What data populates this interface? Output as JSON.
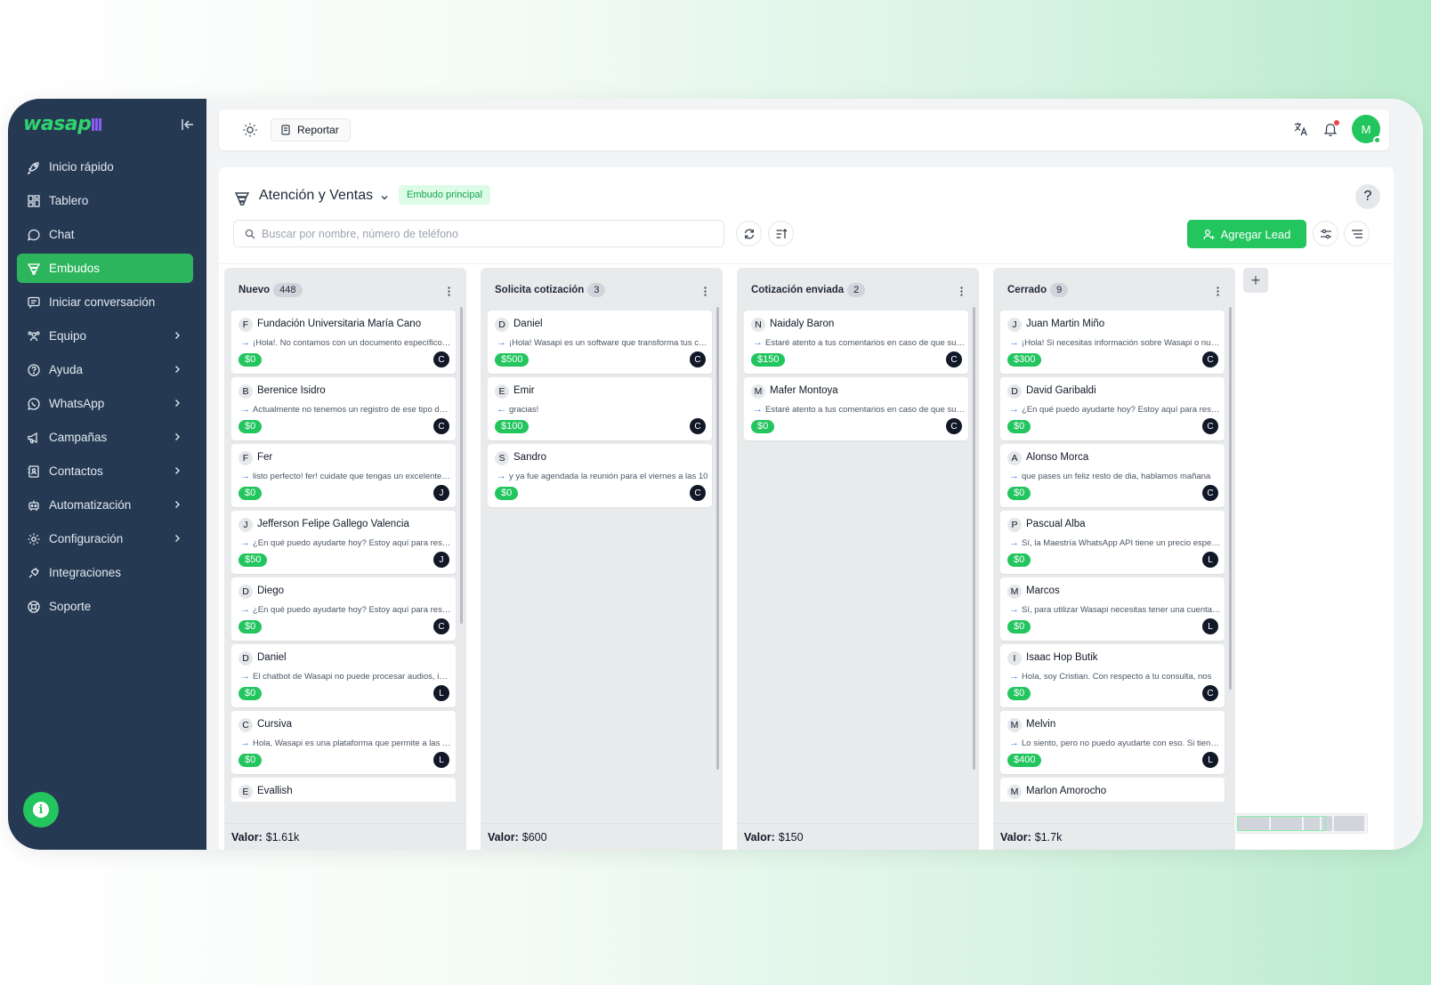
{
  "app": {
    "logo_text": "wasap",
    "brand_color": "#22c55e",
    "sidebar_color": "#253a52"
  },
  "sidebar": {
    "items": [
      {
        "label": "Inicio rápido",
        "icon": "rocket-icon",
        "chevron": false,
        "active": false
      },
      {
        "label": "Tablero",
        "icon": "dashboard-icon",
        "chevron": false,
        "active": false
      },
      {
        "label": "Chat",
        "icon": "chat-bubble-icon",
        "chevron": false,
        "active": false
      },
      {
        "label": "Embudos",
        "icon": "funnel-icon",
        "chevron": false,
        "active": true
      },
      {
        "label": "Iniciar conversación",
        "icon": "message-plus-icon",
        "chevron": false,
        "active": false
      },
      {
        "label": "Equipo",
        "icon": "team-icon",
        "chevron": true,
        "active": false
      },
      {
        "label": "Ayuda",
        "icon": "help-circle-icon",
        "chevron": true,
        "active": false
      },
      {
        "label": "WhatsApp",
        "icon": "whatsapp-icon",
        "chevron": true,
        "active": false
      },
      {
        "label": "Campañas",
        "icon": "megaphone-icon",
        "chevron": true,
        "active": false
      },
      {
        "label": "Contactos",
        "icon": "contacts-icon",
        "chevron": true,
        "active": false
      },
      {
        "label": "Automatización",
        "icon": "robot-icon",
        "chevron": true,
        "active": false
      },
      {
        "label": "Configuración",
        "icon": "gear-icon",
        "chevron": true,
        "active": false
      },
      {
        "label": "Integraciones",
        "icon": "plug-icon",
        "chevron": false,
        "active": false
      },
      {
        "label": "Soporte",
        "icon": "lifebuoy-icon",
        "chevron": false,
        "active": false
      }
    ]
  },
  "topbar": {
    "report_label": "Reportar",
    "avatar_initial": "M"
  },
  "funnel": {
    "title": "Atención y Ventas",
    "badge": "Embudo principal",
    "search_placeholder": "Buscar por nombre, número de teléfono",
    "add_lead_label": "Agregar Lead",
    "help_label": "?",
    "add_column_label": "+"
  },
  "columns": [
    {
      "title": "Nuevo",
      "count": "448",
      "footer_label": "Valor:",
      "footer_value": "$1.61k",
      "cards": [
        {
          "initial": "F",
          "name": "Fundación Universitaria María Cano",
          "arrow": "→",
          "message": "¡Hola!. No contamos con un documento específico sobre eso",
          "value": "$0",
          "agent": "C"
        },
        {
          "initial": "B",
          "name": "Berenice Isidro",
          "arrow": "→",
          "message": "Actualmente no tenemos un registro de ese tipo de información",
          "value": "$0",
          "agent": "C"
        },
        {
          "initial": "F",
          "name": "Fer",
          "arrow": "→",
          "message": "listo perfecto! fer! cuidate que tengas un excelente día",
          "value": "$0",
          "agent": "J"
        },
        {
          "initial": "J",
          "name": "Jefferson Felipe Gallego Valencia",
          "arrow": "→",
          "message": "¿En qué puedo ayudarte hoy? Estoy aquí para responder",
          "value": "$50",
          "agent": "J"
        },
        {
          "initial": "D",
          "name": "Diego",
          "arrow": "→",
          "message": "¿En qué puedo ayudarte hoy? Estoy aquí para responder",
          "value": "$0",
          "agent": "C"
        },
        {
          "initial": "D",
          "name": "Daniel",
          "arrow": "→",
          "message": "El chatbot de Wasapi no puede procesar audios, imágenes",
          "value": "$0",
          "agent": "L"
        },
        {
          "initial": "C",
          "name": "Cursiva",
          "arrow": "→",
          "message": "Hola, Wasapi es una plataforma que permite a las empresas",
          "value": "$0",
          "agent": "L"
        },
        {
          "initial": "E",
          "name": "Evallish",
          "arrow": "→",
          "message": "",
          "value": "",
          "agent": ""
        }
      ]
    },
    {
      "title": "Solicita cotización",
      "count": "3",
      "footer_label": "Valor:",
      "footer_value": "$600",
      "cards": [
        {
          "initial": "D",
          "name": "Daniel",
          "arrow": "→",
          "message": "¡Hola! Wasapi es un software que transforma tus conversaciones",
          "value": "$500",
          "agent": "C"
        },
        {
          "initial": "E",
          "name": "Emir",
          "arrow": "←",
          "message": "gracias!",
          "value": "$100",
          "agent": "C"
        },
        {
          "initial": "S",
          "name": "Sandro",
          "arrow": "→",
          "message": "y ya fue agendada la reunión para el viernes a las 10",
          "value": "$0",
          "agent": "C"
        }
      ]
    },
    {
      "title": "Cotización enviada",
      "count": "2",
      "footer_label": "Valor:",
      "footer_value": "$150",
      "cards": [
        {
          "initial": "N",
          "name": "Naidaly Baron",
          "arrow": "→",
          "message": "Estaré atento a tus comentarios en caso de que surja alguna duda",
          "value": "$150",
          "agent": "C"
        },
        {
          "initial": "M",
          "name": "Mafer Montoya",
          "arrow": "→",
          "message": "Estaré atento a tus comentarios en caso de que surja alguna duda",
          "value": "$0",
          "agent": "C"
        }
      ]
    },
    {
      "title": "Cerrado",
      "count": "9",
      "footer_label": "Valor:",
      "footer_value": "$1.7k",
      "cards": [
        {
          "initial": "J",
          "name": "Juan Martin Miño",
          "arrow": "→",
          "message": "¡Hola! Si necesitas información sobre Wasapi o nuestros planes",
          "value": "$300",
          "agent": "C"
        },
        {
          "initial": "D",
          "name": "David Garibaldi",
          "arrow": "→",
          "message": "¿En qué puedo ayudarte hoy? Estoy aquí para responder",
          "value": "$0",
          "agent": "C"
        },
        {
          "initial": "A",
          "name": "Alonso Morca",
          "arrow": "→",
          "message": "que pases un feliz resto de dia, hablamos mañana",
          "value": "$0",
          "agent": "C"
        },
        {
          "initial": "P",
          "name": "Pascual Alba",
          "arrow": "→",
          "message": "Sí, la Maestría WhatsApp API tiene un precio especial",
          "value": "$0",
          "agent": "L"
        },
        {
          "initial": "M",
          "name": "Marcos",
          "arrow": "→",
          "message": "Sí, para utilizar Wasapi necesitas tener una cuenta activa",
          "value": "$0",
          "agent": "L"
        },
        {
          "initial": "I",
          "name": "Isaac Hop Butik",
          "arrow": "→",
          "message": "Hola, soy Cristian. Con respecto a tu consulta, nos",
          "value": "$0",
          "agent": "C"
        },
        {
          "initial": "M",
          "name": "Melvin",
          "arrow": "→",
          "message": "Lo siento, pero no puedo ayudarte con eso. Si tienes otra",
          "value": "$400",
          "agent": "L"
        },
        {
          "initial": "M",
          "name": "Marlon Amorocho",
          "arrow": "→",
          "message": "",
          "value": "",
          "agent": ""
        }
      ]
    }
  ]
}
